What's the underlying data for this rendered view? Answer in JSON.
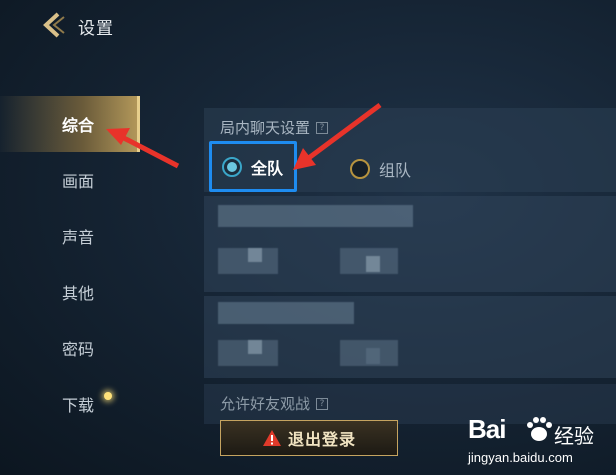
{
  "header": {
    "title": "设置"
  },
  "sidebar": {
    "items": [
      {
        "label": "综合",
        "active": true
      },
      {
        "label": "画面"
      },
      {
        "label": "声音"
      },
      {
        "label": "其他"
      },
      {
        "label": "密码"
      },
      {
        "label": "下载",
        "has_notification": true
      }
    ]
  },
  "chat_settings": {
    "title": "局内聊天设置",
    "help": "?",
    "options": [
      {
        "label": "全队",
        "selected": true
      },
      {
        "label": "组队",
        "selected": false
      }
    ]
  },
  "friend_spectate": {
    "title": "允许好友观战",
    "help": "?"
  },
  "logout_button": {
    "label": "退出登录",
    "icon": "warning-icon"
  },
  "watermark": {
    "brand": "Bai",
    "brand_cn": "经验",
    "url": "jingyan.baidu.com"
  },
  "colors": {
    "accent_gold": "#c5a460",
    "highlight_blue": "#1e8cf0",
    "arrow_red": "#e8332a",
    "radio_blue": "#3aa6c9"
  }
}
